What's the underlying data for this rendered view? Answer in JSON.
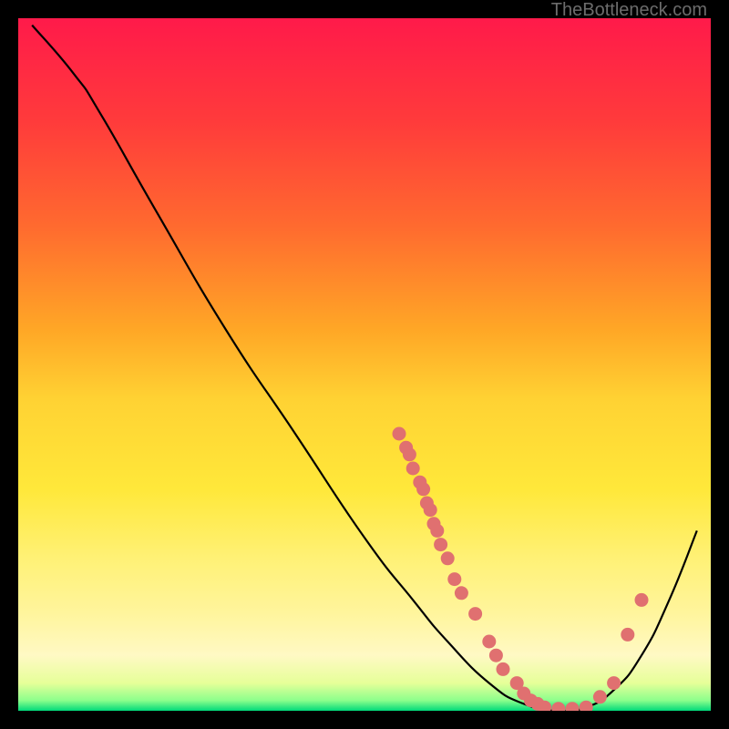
{
  "watermark": "TheBottleneck.com",
  "chart_data": {
    "type": "line",
    "title": "",
    "xlabel": "",
    "ylabel": "",
    "xlim": [
      0,
      100
    ],
    "ylim": [
      0,
      100
    ],
    "curve": [
      {
        "x": 2,
        "y": 99
      },
      {
        "x": 8,
        "y": 92
      },
      {
        "x": 12,
        "y": 86
      },
      {
        "x": 20,
        "y": 72
      },
      {
        "x": 30,
        "y": 55
      },
      {
        "x": 40,
        "y": 40
      },
      {
        "x": 50,
        "y": 25
      },
      {
        "x": 57,
        "y": 16
      },
      {
        "x": 62,
        "y": 10
      },
      {
        "x": 68,
        "y": 4
      },
      {
        "x": 73,
        "y": 1
      },
      {
        "x": 78,
        "y": 0
      },
      {
        "x": 82,
        "y": 0.5
      },
      {
        "x": 86,
        "y": 3
      },
      {
        "x": 90,
        "y": 8
      },
      {
        "x": 94,
        "y": 16
      },
      {
        "x": 98,
        "y": 26
      }
    ],
    "scatter_points": [
      {
        "x": 55,
        "y": 40
      },
      {
        "x": 56,
        "y": 38
      },
      {
        "x": 56.5,
        "y": 37
      },
      {
        "x": 57,
        "y": 35
      },
      {
        "x": 58,
        "y": 33
      },
      {
        "x": 58.5,
        "y": 32
      },
      {
        "x": 59,
        "y": 30
      },
      {
        "x": 59.5,
        "y": 29
      },
      {
        "x": 60,
        "y": 27
      },
      {
        "x": 60.5,
        "y": 26
      },
      {
        "x": 61,
        "y": 24
      },
      {
        "x": 62,
        "y": 22
      },
      {
        "x": 63,
        "y": 19
      },
      {
        "x": 64,
        "y": 17
      },
      {
        "x": 66,
        "y": 14
      },
      {
        "x": 68,
        "y": 10
      },
      {
        "x": 69,
        "y": 8
      },
      {
        "x": 70,
        "y": 6
      },
      {
        "x": 72,
        "y": 4
      },
      {
        "x": 73,
        "y": 2.5
      },
      {
        "x": 74,
        "y": 1.5
      },
      {
        "x": 75,
        "y": 1
      },
      {
        "x": 76,
        "y": 0.5
      },
      {
        "x": 78,
        "y": 0.3
      },
      {
        "x": 80,
        "y": 0.3
      },
      {
        "x": 82,
        "y": 0.5
      },
      {
        "x": 84,
        "y": 2
      },
      {
        "x": 86,
        "y": 4
      },
      {
        "x": 88,
        "y": 11
      },
      {
        "x": 90,
        "y": 16
      }
    ],
    "gradient_stops": [
      {
        "offset": 0.0,
        "color": "#ff1a4a"
      },
      {
        "offset": 0.15,
        "color": "#ff3b3b"
      },
      {
        "offset": 0.3,
        "color": "#ff6a2f"
      },
      {
        "offset": 0.45,
        "color": "#ffa726"
      },
      {
        "offset": 0.55,
        "color": "#ffd233"
      },
      {
        "offset": 0.68,
        "color": "#ffe83a"
      },
      {
        "offset": 0.78,
        "color": "#fff176"
      },
      {
        "offset": 0.86,
        "color": "#fff59d"
      },
      {
        "offset": 0.92,
        "color": "#fff9c4"
      },
      {
        "offset": 0.96,
        "color": "#e6ff99"
      },
      {
        "offset": 0.985,
        "color": "#8cff8c"
      },
      {
        "offset": 1.0,
        "color": "#00d97a"
      }
    ],
    "point_color": "#e07070",
    "curve_color": "#000000"
  }
}
